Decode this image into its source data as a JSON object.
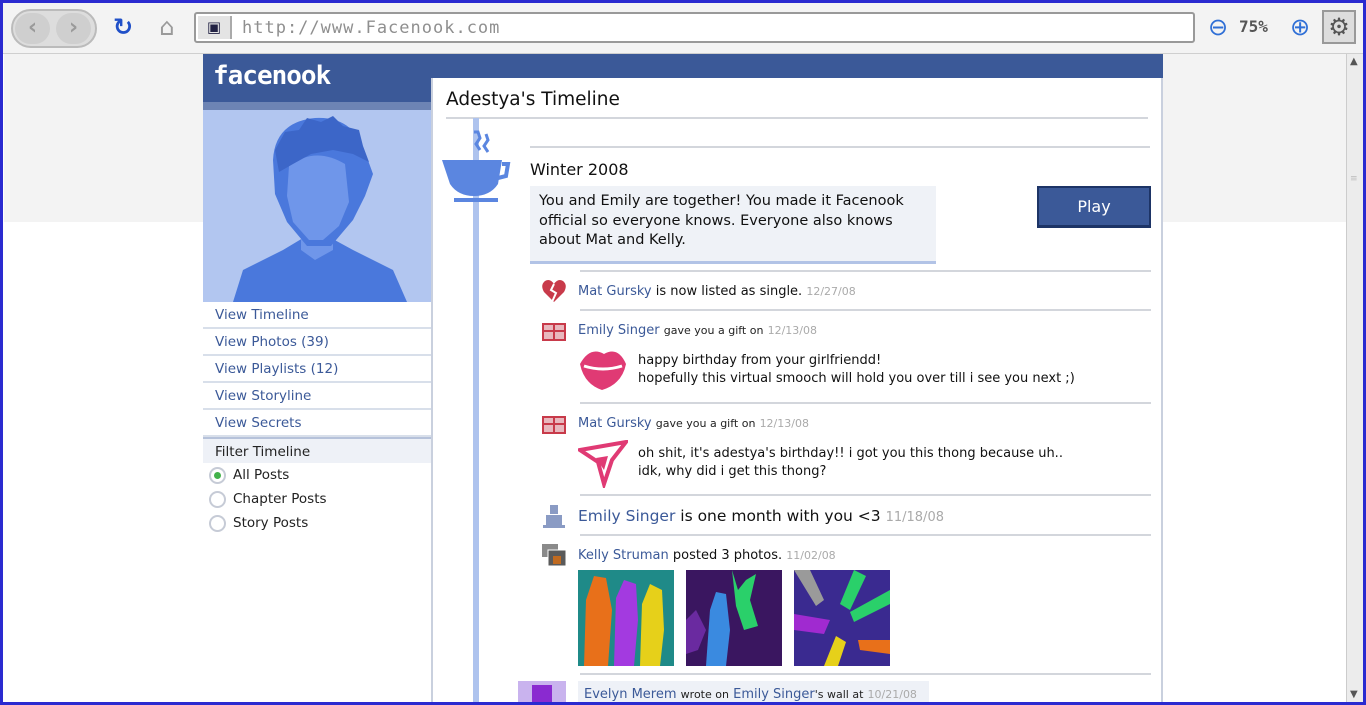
{
  "browser": {
    "url": "http://www.Facenook.com",
    "zoom": "75%"
  },
  "site": {
    "logo": "facenook"
  },
  "sidebar": {
    "nav": [
      {
        "label": "View Timeline"
      },
      {
        "label": "View Photos (39)"
      },
      {
        "label": "View Playlists (12)"
      },
      {
        "label": "View Storyline"
      },
      {
        "label": "View Secrets"
      }
    ],
    "filter_title": "Filter Timeline",
    "filters": [
      {
        "label": "All Posts",
        "selected": true
      },
      {
        "label": "Chapter Posts",
        "selected": false
      },
      {
        "label": "Story Posts",
        "selected": false
      }
    ]
  },
  "timeline": {
    "title": "Adestya's Timeline",
    "season": "Winter 2008",
    "chapter_text_1": "You and Emily are together! You made it Facenook",
    "chapter_text_2": "official so everyone knows. Everyone also knows",
    "chapter_text_3": "about Mat and Kelly.",
    "play_label": "Play",
    "posts": {
      "p1": {
        "name": "Mat Gursky",
        "text": "is now listed as single.",
        "date": "12/27/08",
        "icon": "broken-heart-icon"
      },
      "p2": {
        "name": "Emily Singer",
        "action": "gave you a gift on",
        "date": "12/13/08",
        "icon": "gift-icon",
        "gift": "lips-icon",
        "line1": "happy birthday from your girlfriendd!",
        "line2": "hopefully this virtual smooch will hold you over till i see you next ;)"
      },
      "p3": {
        "name": "Mat Gursky",
        "action": "gave you a gift on",
        "date": "12/13/08",
        "icon": "gift-icon",
        "gift": "thong-icon",
        "line1": "oh shit, it's adestya's birthday!! i got you this thong because uh..",
        "line2": "idk, why did i get this thong?"
      },
      "p4": {
        "name": "Emily Singer",
        "text": "is one month with you <3",
        "date": "11/18/08",
        "icon": "person-icon"
      },
      "p5": {
        "name": "Kelly Struman",
        "text": "posted 3 photos.",
        "date": "11/02/08",
        "icon": "photos-icon"
      },
      "p6": {
        "name": "Evelyn Merem",
        "action": "wrote on",
        "target": "Emily Singer",
        "suffix": "'s wall at",
        "date": "10/21/08"
      }
    }
  },
  "colors": {
    "brand": "#3b5998",
    "timeline_spine": "#aec3ee",
    "avatar_bg": "#b2c6f0"
  }
}
